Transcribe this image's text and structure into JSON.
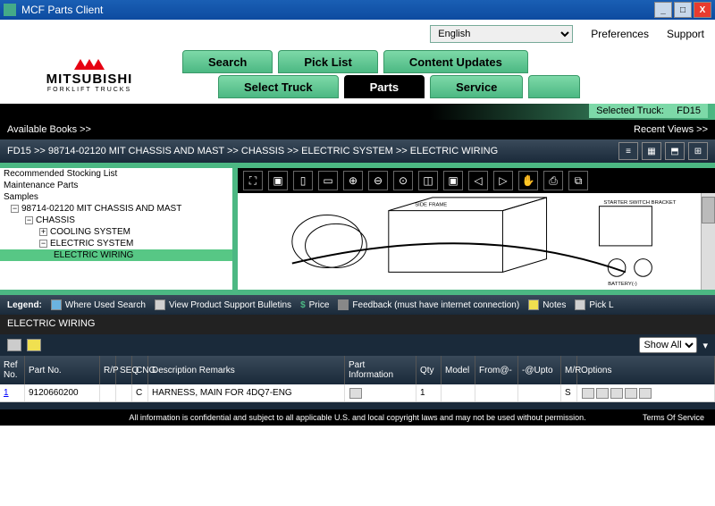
{
  "window": {
    "title": "MCF Parts Client"
  },
  "topbar": {
    "language": "English",
    "preferences": "Preferences",
    "support": "Support"
  },
  "logo": {
    "brand": "MITSUBISHI",
    "sub": "FORKLIFT TRUCKS"
  },
  "tabs_row1": [
    {
      "label": "Search"
    },
    {
      "label": "Pick List"
    },
    {
      "label": "Content Updates"
    }
  ],
  "tabs_row2": [
    {
      "label": "Select Truck"
    },
    {
      "label": "Parts",
      "active": true
    },
    {
      "label": "Service"
    }
  ],
  "selected_truck": {
    "label": "Selected Truck:",
    "value": "FD15"
  },
  "navbar": {
    "left": "Available Books >>",
    "right": "Recent Views >>"
  },
  "breadcrumb": "FD15 >> 98714-02120 MIT CHASSIS AND MAST >> CHASSIS >> ELECTRIC SYSTEM >> ELECTRIC WIRING",
  "tree": {
    "top_items": [
      "Recommended Stocking List",
      "Maintenance Parts",
      "Samples"
    ],
    "book": "98714-02120 MIT CHASSIS AND MAST",
    "chassis": "CHASSIS",
    "cooling": "COOLING SYSTEM",
    "electric": "ELECTRIC SYSTEM",
    "wiring": "ELECTRIC WIRING"
  },
  "legend": {
    "label": "Legend:",
    "items": [
      {
        "label": "Where Used Search",
        "color": "#6bb3e0"
      },
      {
        "label": "View Product Support Bulletins",
        "color": "#d0d0d0"
      },
      {
        "label": "Price",
        "color": "#4cb883",
        "glyph": "$"
      },
      {
        "label": "Feedback (must have internet connection)",
        "color": "#888"
      },
      {
        "label": "Notes",
        "color": "#f0e050"
      },
      {
        "label": "Pick L",
        "color": "#d0d0d0"
      }
    ]
  },
  "section_title": "ELECTRIC WIRING",
  "show_all": "Show All",
  "grid": {
    "headers": {
      "ref": "Ref No.",
      "part": "Part No.",
      "rp": "R/P",
      "seq": "SEQ",
      "cng": "CNG",
      "desc": "Description Remarks",
      "info": "Part Information",
      "qty": "Qty",
      "model": "Model",
      "from": "From@-",
      "upto": "-@Upto",
      "mr": "M/R",
      "opt": "Options"
    },
    "rows": [
      {
        "ref": "1",
        "part": "9120660200",
        "rp": "",
        "seq": "",
        "cng": "C",
        "desc": "HARNESS, MAIN FOR 4DQ7-ENG",
        "info": "",
        "qty": "1",
        "model": "",
        "from": "",
        "upto": "",
        "mr": "S"
      }
    ]
  },
  "footer": {
    "text": "All information is confidential and subject to all applicable U.S. and local copyright laws and may not be used without permission.",
    "tos": "Terms Of Service"
  }
}
